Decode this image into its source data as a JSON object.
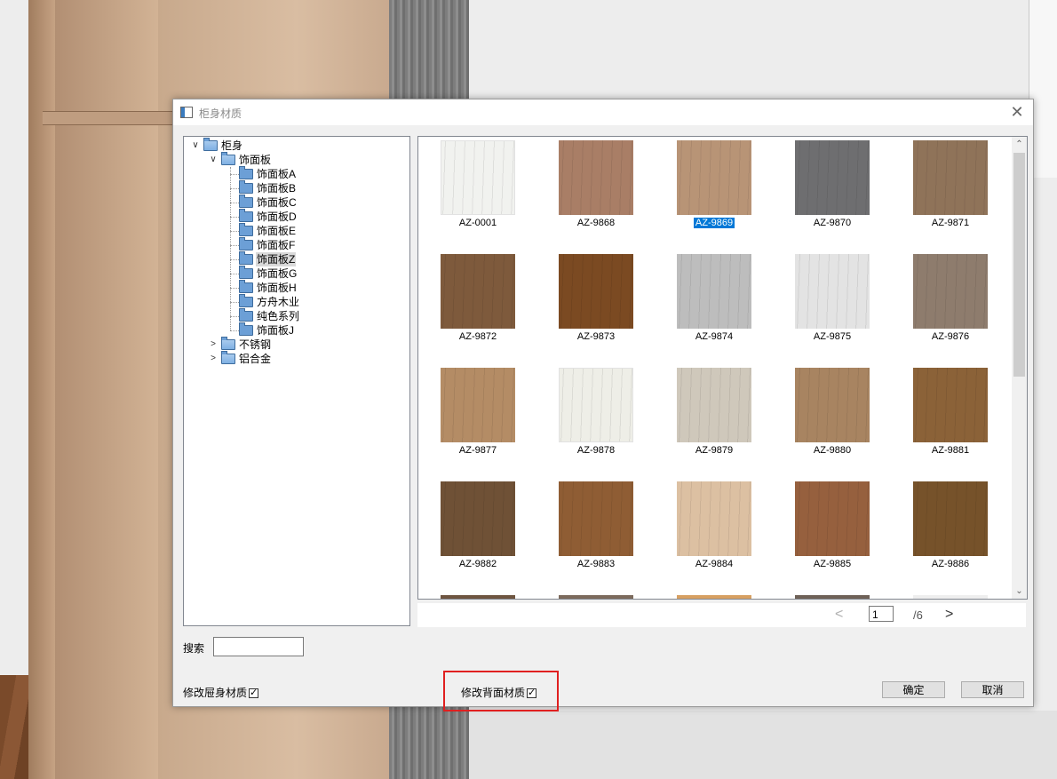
{
  "dialog": {
    "title": "柜身材质",
    "close_glyph": "✕"
  },
  "tree": {
    "root": "柜身",
    "group1": "饰面板",
    "children": [
      "饰面板A",
      "饰面板B",
      "饰面板C",
      "饰面板D",
      "饰面板E",
      "饰面板F",
      "饰面板Z",
      "饰面板G",
      "饰面板H",
      "方舟木业",
      "纯色系列",
      "饰面板J"
    ],
    "selected_child": "饰面板Z",
    "group2": "不锈钢",
    "group3": "铝合金",
    "expand_glyph": "∨",
    "collapse_glyph": ">"
  },
  "materials": [
    {
      "code": "AZ-0001",
      "color": "#f1f2ef",
      "selected": false
    },
    {
      "code": "AZ-9868",
      "color": "#a97e66",
      "selected": false
    },
    {
      "code": "AZ-9869",
      "color": "#b89476",
      "selected": true
    },
    {
      "code": "AZ-9870",
      "color": "#6e6e70",
      "selected": false
    },
    {
      "code": "AZ-9871",
      "color": "#8f7359",
      "selected": false
    },
    {
      "code": "AZ-9872",
      "color": "#7e5a3c",
      "selected": false
    },
    {
      "code": "AZ-9873",
      "color": "#7b4a22",
      "selected": false
    },
    {
      "code": "AZ-9874",
      "color": "#bdbdbd",
      "selected": false
    },
    {
      "code": "AZ-9875",
      "color": "#e3e3e3",
      "selected": false
    },
    {
      "code": "AZ-9876",
      "color": "#8e7c6d",
      "selected": false
    },
    {
      "code": "AZ-9877",
      "color": "#b48c65",
      "selected": false
    },
    {
      "code": "AZ-9878",
      "color": "#eeeee7",
      "selected": false
    },
    {
      "code": "AZ-9879",
      "color": "#cfc8bb",
      "selected": false
    },
    {
      "code": "AZ-9880",
      "color": "#a88461",
      "selected": false
    },
    {
      "code": "AZ-9881",
      "color": "#8b6238",
      "selected": false
    },
    {
      "code": "AZ-9882",
      "color": "#6f5136",
      "selected": false
    },
    {
      "code": "AZ-9883",
      "color": "#8f5d34",
      "selected": false
    },
    {
      "code": "AZ-9884",
      "color": "#dcc0a2",
      "selected": false
    },
    {
      "code": "AZ-9885",
      "color": "#96603e",
      "selected": false
    },
    {
      "code": "AZ-9886",
      "color": "#76522a",
      "selected": false
    }
  ],
  "partial_row_colors": [
    "#6e5540",
    "#7c6a5c",
    "#d7a062",
    "#6e6157",
    "#eeeeee"
  ],
  "pager": {
    "prev": "<",
    "current": "1",
    "total": "/6",
    "next": ">"
  },
  "search": {
    "label": "搜索",
    "value": ""
  },
  "options": {
    "body_label": "修改屉身材质",
    "back_label": "修改背面材质"
  },
  "buttons": {
    "ok": "确定",
    "cancel": "取消"
  },
  "scroll": {
    "up": "⌃",
    "down": "⌄"
  },
  "colors": {
    "selection": "#0078d7",
    "highlight_box": "#e02020"
  }
}
